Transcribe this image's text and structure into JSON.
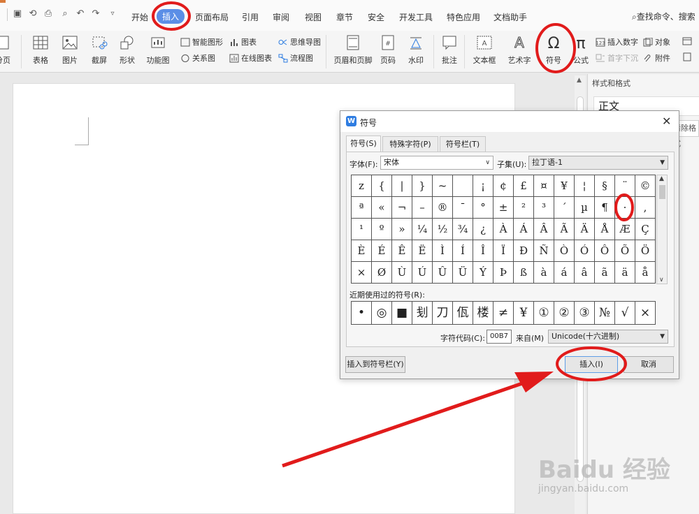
{
  "menu": {
    "tabs": [
      "开始",
      "插入",
      "页面布局",
      "引用",
      "审阅",
      "视图",
      "章节",
      "安全",
      "开发工具",
      "特色应用",
      "文档助手"
    ],
    "active_tab": "插入",
    "search": "查找命令、搜索"
  },
  "ribbon": {
    "page": "分页",
    "table": "表格",
    "picture": "图片",
    "screenshot": "截屏",
    "shape": "形状",
    "function_chart": "功能图",
    "smart_shape": "智能图形",
    "chart": "图表",
    "mind_map": "思维导图",
    "relation": "关系图",
    "online_chart": "在线图表",
    "flowchart": "流程图",
    "header_footer": "页眉和页脚",
    "page_number": "页码",
    "watermark": "水印",
    "comment": "批注",
    "textbox": "文本框",
    "art_text": "艺术字",
    "symbol": "符号",
    "formula": "公式",
    "insert_number": "插入数字",
    "object": "对象",
    "drop_cap": "首字下沉",
    "attachment": "附件"
  },
  "panel": {
    "title": "样式和格式",
    "style": "正文",
    "clear": "清除格式"
  },
  "dialog": {
    "title": "符号",
    "tabs": [
      "符号(S)",
      "特殊字符(P)",
      "符号栏(T)"
    ],
    "font_label": "字体(F):",
    "font_value": "宋体",
    "subset_label": "子集(U):",
    "subset_value": "拉丁语-1",
    "grid": [
      [
        "z",
        "{",
        "|",
        "}",
        "~",
        "",
        "¡",
        "¢",
        "£",
        "¤",
        "¥",
        "¦",
        "§",
        "¨",
        "©"
      ],
      [
        "ª",
        "«",
        "¬",
        "–",
        "®",
        "¯",
        "°",
        "±",
        "²",
        "³",
        "´",
        "µ",
        "¶",
        "·",
        ","
      ],
      [
        "¹",
        "º",
        "»",
        "¼",
        "½",
        "¾",
        "¿",
        "À",
        "Á",
        "Â",
        "Ã",
        "Ä",
        "Å",
        "Æ",
        "Ç"
      ],
      [
        "È",
        "É",
        "Ê",
        "Ë",
        "Ì",
        "Í",
        "Î",
        "Ï",
        "Ð",
        "Ñ",
        "Ò",
        "Ó",
        "Ô",
        "Õ",
        "Ö"
      ],
      [
        "×",
        "Ø",
        "Ù",
        "Ú",
        "Û",
        "Ü",
        "Ý",
        "Þ",
        "ß",
        "à",
        "á",
        "â",
        "ã",
        "ä",
        "å"
      ]
    ],
    "recent_label": "近期使用过的符号(R):",
    "recent": [
      "•",
      "◎",
      "■",
      "刬",
      "刀",
      "佤",
      "楼",
      "≠",
      "¥",
      "①",
      "②",
      "③",
      "№",
      "√",
      "×"
    ],
    "code_label": "字符代码(C):",
    "code_value": "00B7",
    "from_label": "来自(M)",
    "from_value": "Unicode(十六进制)",
    "insert_to_bar": "插入到符号栏(Y)",
    "insert": "插入(I)",
    "cancel": "取消"
  },
  "watermark": {
    "logo": "Baidu 经验",
    "url": "jingyan.baidu.com"
  },
  "colors": {
    "accent": "#5b8ee6",
    "annotation": "#e11b1b"
  }
}
